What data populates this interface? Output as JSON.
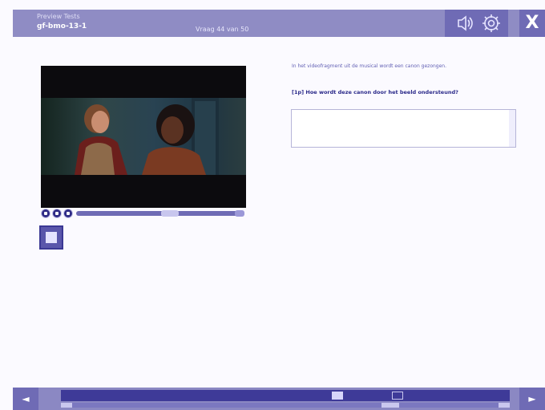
{
  "header": {
    "title_line1": "Preview Tests",
    "title_line2": "gf-bmo-13-1",
    "progress_text": "Vraag 44 van 50",
    "close_label": "X"
  },
  "question": {
    "intro": "In het videofragment uit de musical wordt een canon gezongen.",
    "prompt": "[1p] Hoe wordt deze canon door het beeld ondersteund?",
    "answer_value": ""
  },
  "player": {
    "progress_fraction": 0.6
  },
  "footer": {
    "prev_label": "◄",
    "next_label": "►",
    "pages": [
      "",
      "",
      "",
      "",
      "",
      "",
      "",
      "",
      "",
      "",
      "",
      "",
      "",
      "",
      "",
      "",
      "",
      "",
      "",
      "",
      "",
      "",
      "",
      "",
      "",
      "",
      "",
      "",
      "",
      ""
    ],
    "active_page_index": 18,
    "outlined_page_index": 22
  },
  "icons": {
    "header_left": "speaker-icon",
    "header_right": "settings-gear-icon",
    "camera": "video-camera-icon"
  }
}
